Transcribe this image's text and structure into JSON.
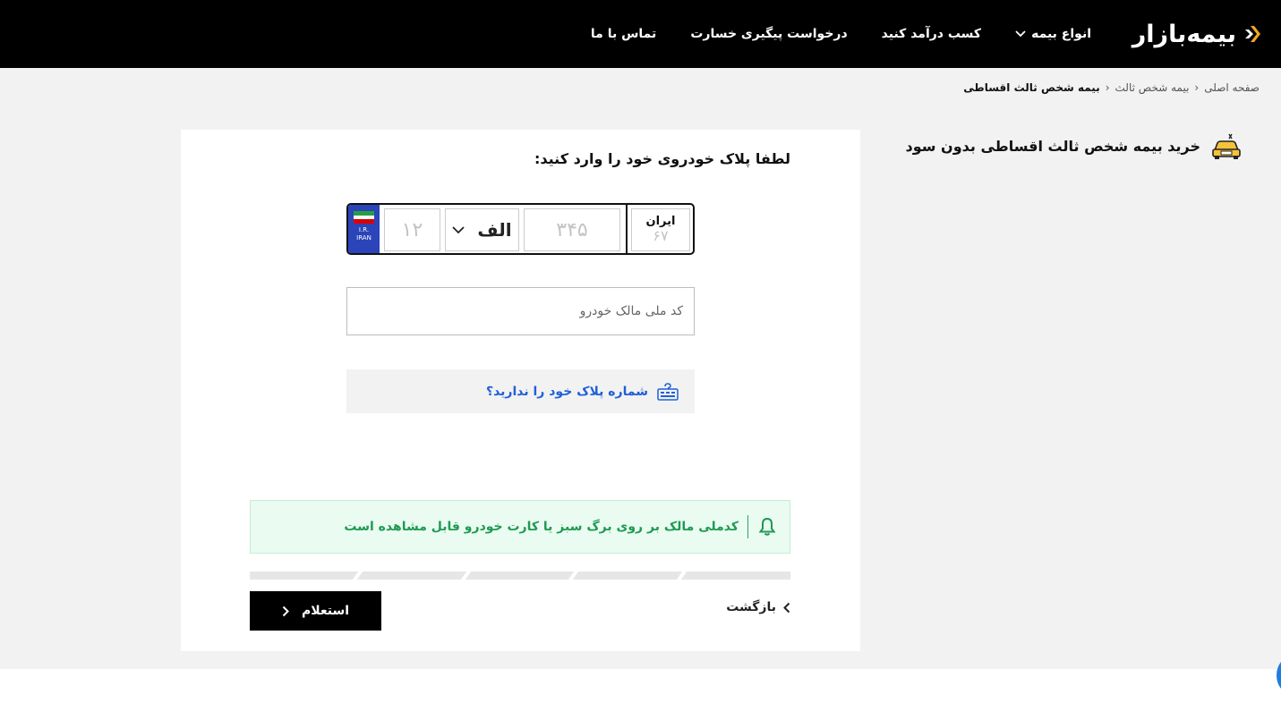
{
  "header": {
    "logo_text": "بیمه‌بازار",
    "nav": [
      {
        "label": "انواع بیمه",
        "has_dropdown": true
      },
      {
        "label": "کسب درآمد کنید"
      },
      {
        "label": "درخواست پیگیری خسارت"
      },
      {
        "label": "تماس با ما"
      }
    ]
  },
  "breadcrumb": [
    "صفحه اصلی",
    "بیمه شخص ثالث",
    "بیمه شخص ثالث اقساطی"
  ],
  "page_title": "خرید بیمه شخص ثالث اقساطی بدون سود",
  "form": {
    "prompt": "لطفا پلاک خودروی خود را وارد کنید:",
    "plate": {
      "flag_text_1": "I.R.",
      "flag_text_2": "IRAN",
      "two_digit_placeholder": "۱۲",
      "letter_selected": "الف",
      "three_digit_placeholder": "۳۴۵",
      "region_label": "ایران",
      "region_placeholder": "۶۷"
    },
    "national_code_placeholder": "کد ملی مالک خودرو",
    "no_plate_link": "شماره پلاک خود را ندارید؟",
    "notice": "کدملی مالک بر روی برگ سبز یا کارت خودرو قابل مشاهده است",
    "progress_steps": 5,
    "inquiry_button": "استعلام",
    "back_button": "بازگشت"
  },
  "colors": {
    "header_bg": "#000000",
    "accent_orange": "#f5a623",
    "link_blue": "#2060d8",
    "notice_green": "#1f9a52",
    "plate_blue": "#2b44b9"
  }
}
